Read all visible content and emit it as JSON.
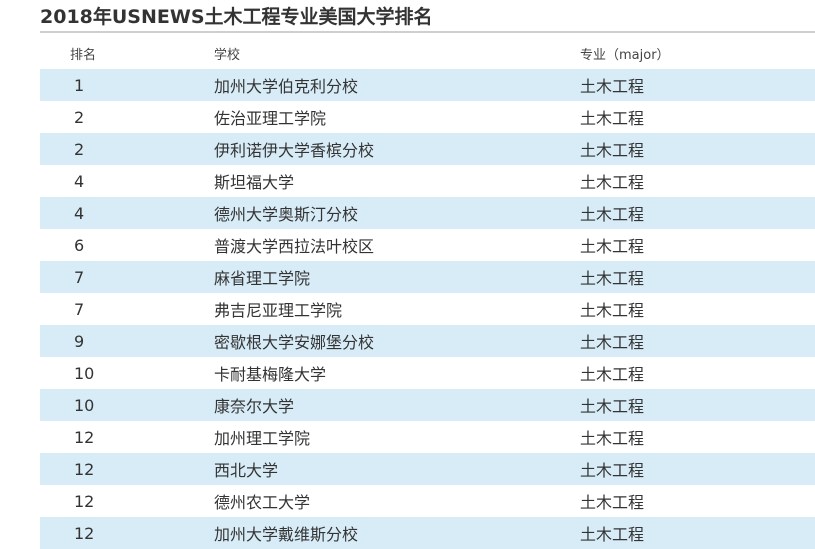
{
  "title": "2018年USNEWS土木工程专业美国大学排名",
  "table": {
    "headers": {
      "rank": "排名",
      "school": "学校",
      "major": "专业（major）"
    },
    "rows": [
      {
        "rank": "1",
        "school": "加州大学伯克利分校",
        "major": "土木工程"
      },
      {
        "rank": "2",
        "school": "佐治亚理工学院",
        "major": "土木工程"
      },
      {
        "rank": "2",
        "school": "伊利诺伊大学香槟分校",
        "major": "土木工程"
      },
      {
        "rank": "4",
        "school": "斯坦福大学",
        "major": "土木工程"
      },
      {
        "rank": "4",
        "school": "德州大学奥斯汀分校",
        "major": "土木工程"
      },
      {
        "rank": "6",
        "school": "普渡大学西拉法叶校区",
        "major": "土木工程"
      },
      {
        "rank": "7",
        "school": "麻省理工学院",
        "major": "土木工程"
      },
      {
        "rank": "7",
        "school": "弗吉尼亚理工学院",
        "major": "土木工程"
      },
      {
        "rank": "9",
        "school": "密歇根大学安娜堡分校",
        "major": "土木工程"
      },
      {
        "rank": "10",
        "school": "卡耐基梅隆大学",
        "major": "土木工程"
      },
      {
        "rank": "10",
        "school": "康奈尔大学",
        "major": "土木工程"
      },
      {
        "rank": "12",
        "school": "加州理工学院",
        "major": "土木工程"
      },
      {
        "rank": "12",
        "school": "西北大学",
        "major": "土木工程"
      },
      {
        "rank": "12",
        "school": "德州农工大学",
        "major": "土木工程"
      },
      {
        "rank": "12",
        "school": "加州大学戴维斯分校",
        "major": "土木工程"
      }
    ]
  },
  "colors": {
    "stripe": "#d8ecf8",
    "rule": "#cfcfcf",
    "text": "#333333"
  }
}
